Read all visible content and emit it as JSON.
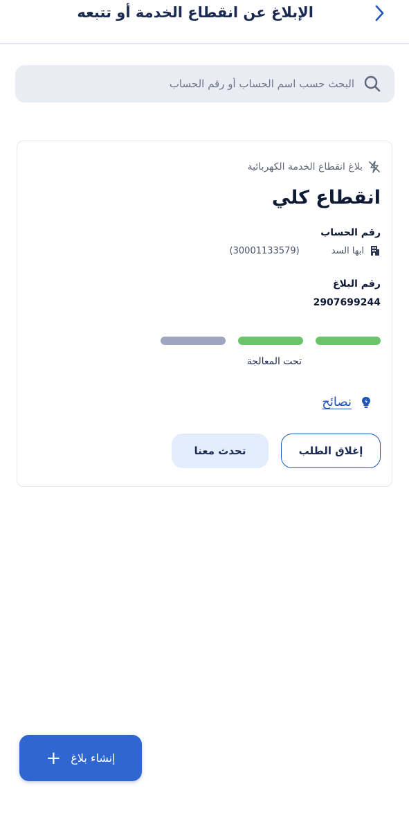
{
  "header": {
    "title": "الإبلاغ عن انقطاع الخدمة أو تتبعه",
    "back_icon": "chevron-left-icon"
  },
  "search": {
    "placeholder": "البحث حسب اسم الحساب أو رقم الحساب",
    "value": "",
    "icon": "search-icon"
  },
  "report_card": {
    "type_label": "بلاغ انقطاع الخدمة الكهربائية",
    "type_icon": "no-power-icon",
    "title": "انقطاع كلي",
    "account_label": "رقم الحساب",
    "account_name": "ابها السد",
    "account_icon": "building-icon",
    "account_number": "(30001133579)",
    "ticket_label": "رقم البلاغ",
    "ticket_number": "2907699244",
    "progress": {
      "steps_total": 3,
      "steps_completed": 2,
      "colors": {
        "done": "#6cc46a",
        "pending": "#9da6bf"
      },
      "status_label": "تحت المعالجة"
    },
    "tips_label": "نصائح",
    "tips_icon": "lightbulb-icon",
    "close_button": "إغلاق الطلب",
    "talk_button": "تحدث معنا"
  },
  "fab": {
    "label": "إنشاء بلاغ",
    "icon": "plus-icon"
  },
  "colors": {
    "primary": "#2f66cf",
    "link": "#1f55b8",
    "title": "#1b2a52",
    "search_bg": "#e9ecf3",
    "talk_bg": "#e4edfb"
  }
}
